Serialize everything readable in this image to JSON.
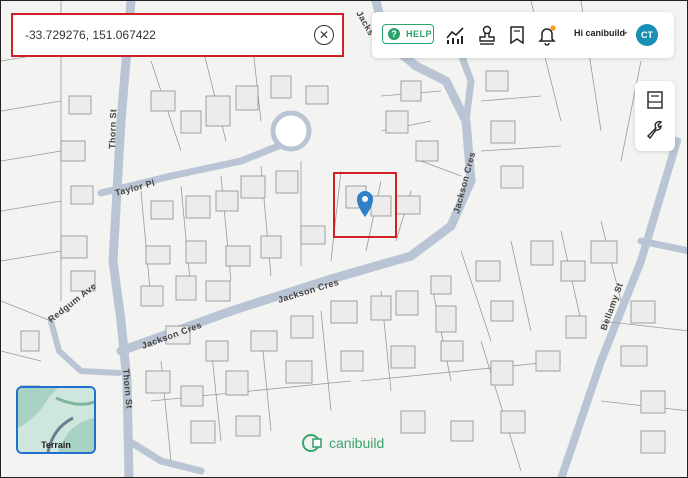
{
  "search": {
    "value": "-33.729276, 151.067422"
  },
  "header": {
    "help_label": "HELP",
    "greeting": "Hi canibuild",
    "avatar_initials": "CT"
  },
  "map": {
    "streets": [
      "Thorn St",
      "Taylor Pl",
      "Jackson Cres",
      "Jackson Cres",
      "Jackson Cres",
      "Redgum Ave",
      "Thorn St",
      "Bellamy St",
      "Jacks"
    ]
  },
  "layer_toggle": {
    "label": "Terrain"
  },
  "watermark": {
    "text": "canibuild"
  },
  "colors": {
    "accent": "#2aa36a",
    "highlight": "#d11f26",
    "marker": "#2f7fc9",
    "avatar": "#1a8fb5"
  }
}
